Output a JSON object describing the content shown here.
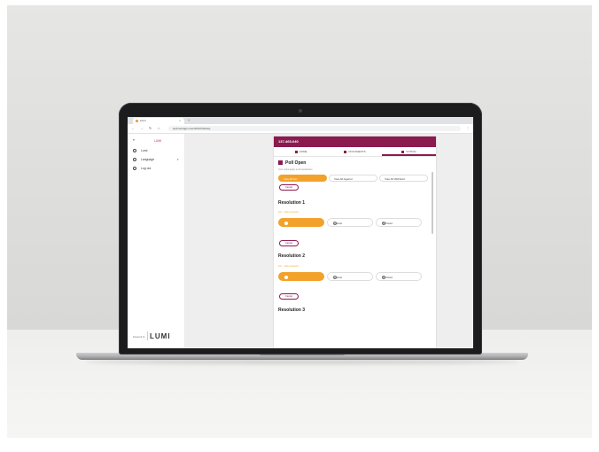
{
  "browser": {
    "tab_title": "Lumi",
    "tab_close": "×",
    "tab_add": "+",
    "url": "web.lumiagm.com/#/137/activity"
  },
  "sidebar": {
    "brand": "LUMI",
    "items": [
      {
        "label": "Lumi"
      },
      {
        "label": "Language",
        "caret": "▾"
      },
      {
        "label": "Log out"
      }
    ],
    "powered_by": "Powered by",
    "logo": "LUMI"
  },
  "panel": {
    "meeting_id": "137-465-040",
    "tabs": [
      {
        "label": "HOME"
      },
      {
        "label": "DOCUMENTS"
      },
      {
        "label": "VOTING"
      }
    ],
    "poll_title": "Poll Open",
    "poll_subtitle": "Your votes apply to all resolutions",
    "all_options": [
      {
        "label": "Vote All For"
      },
      {
        "label": "Vote All Against"
      },
      {
        "label": "Vote All Withhold"
      }
    ],
    "cancel_label": "Cancel",
    "resolutions": [
      {
        "title": "Resolution 1",
        "note": "For – Vote received",
        "options": [
          {
            "label": "For"
          },
          {
            "label": "Against"
          },
          {
            "label": "Withhold"
          }
        ],
        "cancel": "Cancel"
      },
      {
        "title": "Resolution 2",
        "note": "For – Vote received",
        "options": [
          {
            "label": "For"
          },
          {
            "label": "Against"
          },
          {
            "label": "Withhold"
          }
        ],
        "cancel": "Cancel"
      },
      {
        "title": "Resolution 3"
      }
    ]
  },
  "colors": {
    "brand": "#8b1a4e",
    "accent": "#f2a22b"
  }
}
